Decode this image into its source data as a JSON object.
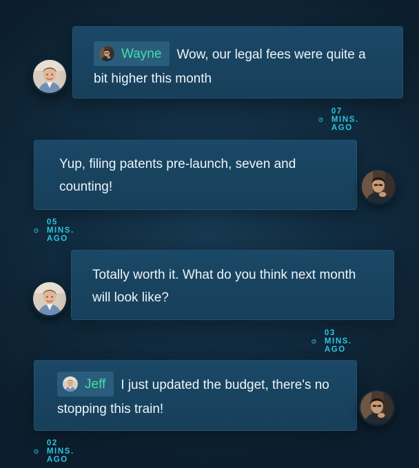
{
  "colors": {
    "background": "#112c40",
    "bubble": "#1a4866",
    "mention_bg": "#2a5d7c",
    "mention_name": "#3fe0a8",
    "timestamp": "#2ec4e0"
  },
  "messages": [
    {
      "mention": "Wayne",
      "text": "Wow, our legal fees were quite a bit higher this month",
      "time": "07 MINS. AGO",
      "avatar": "wayne-avatar"
    },
    {
      "mention": "",
      "text": "Yup, filing patents pre-launch, seven and counting!",
      "time": "05 MINS. AGO",
      "avatar": "jeff-avatar"
    },
    {
      "mention": "",
      "text": "Totally worth it. What do you think next month will look like?",
      "time": "03 MINS. AGO",
      "avatar": "wayne-avatar"
    },
    {
      "mention": "Jeff",
      "text": "I just updated the budget, there's no stopping this train!",
      "time": "02 MINS. AGO",
      "avatar": "jeff-avatar"
    }
  ]
}
